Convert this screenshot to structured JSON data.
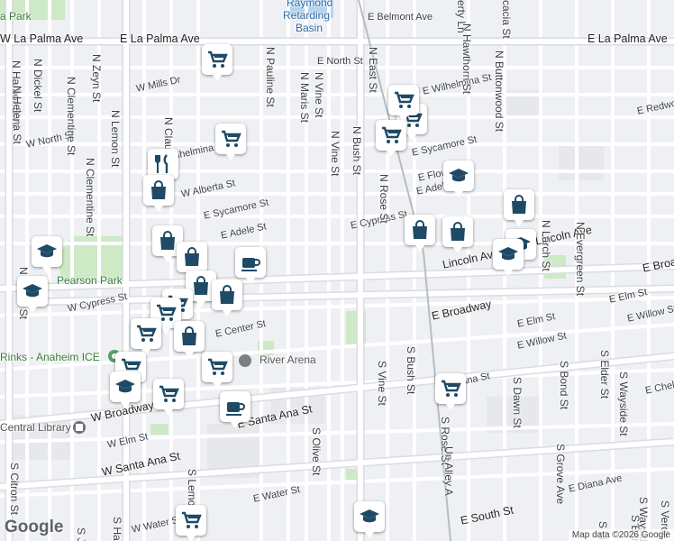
{
  "map": {
    "streets_major": [
      "W La Palma Ave",
      "E La Palma Ave",
      "E La Palma Ave",
      "Lincoln Ave",
      "Lincoln Ave",
      "E Broadway",
      "E Broadway",
      "W Broadway",
      "E Santa Ana St",
      "W Santa Ana St",
      "E South St"
    ],
    "streets": [
      "E North St",
      "E Belmont Ave",
      "E Wilhelmina St",
      "E Redwo",
      "E Sycamore St",
      "E Sycamore St",
      "E Flower St",
      "E Adele St",
      "E Adele St",
      "E Cypress St",
      "W Cypress St",
      "E Elm St",
      "E Elm St",
      "E Willow St",
      "E Willow St",
      "W Elm St",
      "E Water St",
      "W Water St",
      "E Diana Ave",
      "E Chel",
      "W North St",
      "W Alberta St",
      "W Wilhelmina St",
      "E Center St",
      "W Mills Dr",
      "Ana St"
    ],
    "streets_vertical": [
      "N Harbor Blvd",
      "N Helena St",
      "N Dickel St",
      "N Clementine St",
      "N Clementine St",
      "N Zeyn St",
      "N Lemon St",
      "N Claudina St",
      "N Pauline St",
      "N Maris St",
      "N Vine St",
      "N Vine St",
      "N Bush St",
      "N Rose St",
      "N East St",
      "N Hawthorn St",
      "N Buttonwood St",
      "N Larch St",
      "N Evergreen St",
      "S Vine St",
      "S Bush St",
      "S Dawn St",
      "S Rose St",
      "Un Alley A",
      "S Grove Ave",
      "S Bond St",
      "S Elder St",
      "S Wayside St",
      "S Olive St",
      "S Lemon St",
      "S Citron St",
      "N Janss St",
      "S Harbor",
      "erty Ln",
      "cacia St",
      "Alley",
      "S J",
      "S Verde St",
      "S Wayside St",
      "S Barnett",
      "S Li"
    ],
    "pois": [
      "Pearson Park",
      "River Arena",
      "Rinks - Anaheim ICE",
      "Central Library",
      "a Park"
    ],
    "basin": [
      "Raymond",
      "Retarding",
      "Basin"
    ],
    "brand": "Google",
    "attribution": "Map data ©2026 Google"
  },
  "icons": {
    "cart": "shopping-cart-icon",
    "bag": "shopping-bag-icon",
    "cap": "graduation-cap-icon",
    "cup": "coffee-cup-icon",
    "dining": "fork-knife-icon",
    "cross": "cross-icon",
    "pin": "location-pin-icon"
  },
  "colors": {
    "icon": "#1f4a66",
    "park": "#cde9c6",
    "water": "#b3d4f0",
    "road": "#ffffff",
    "land": "#eef0f3"
  }
}
